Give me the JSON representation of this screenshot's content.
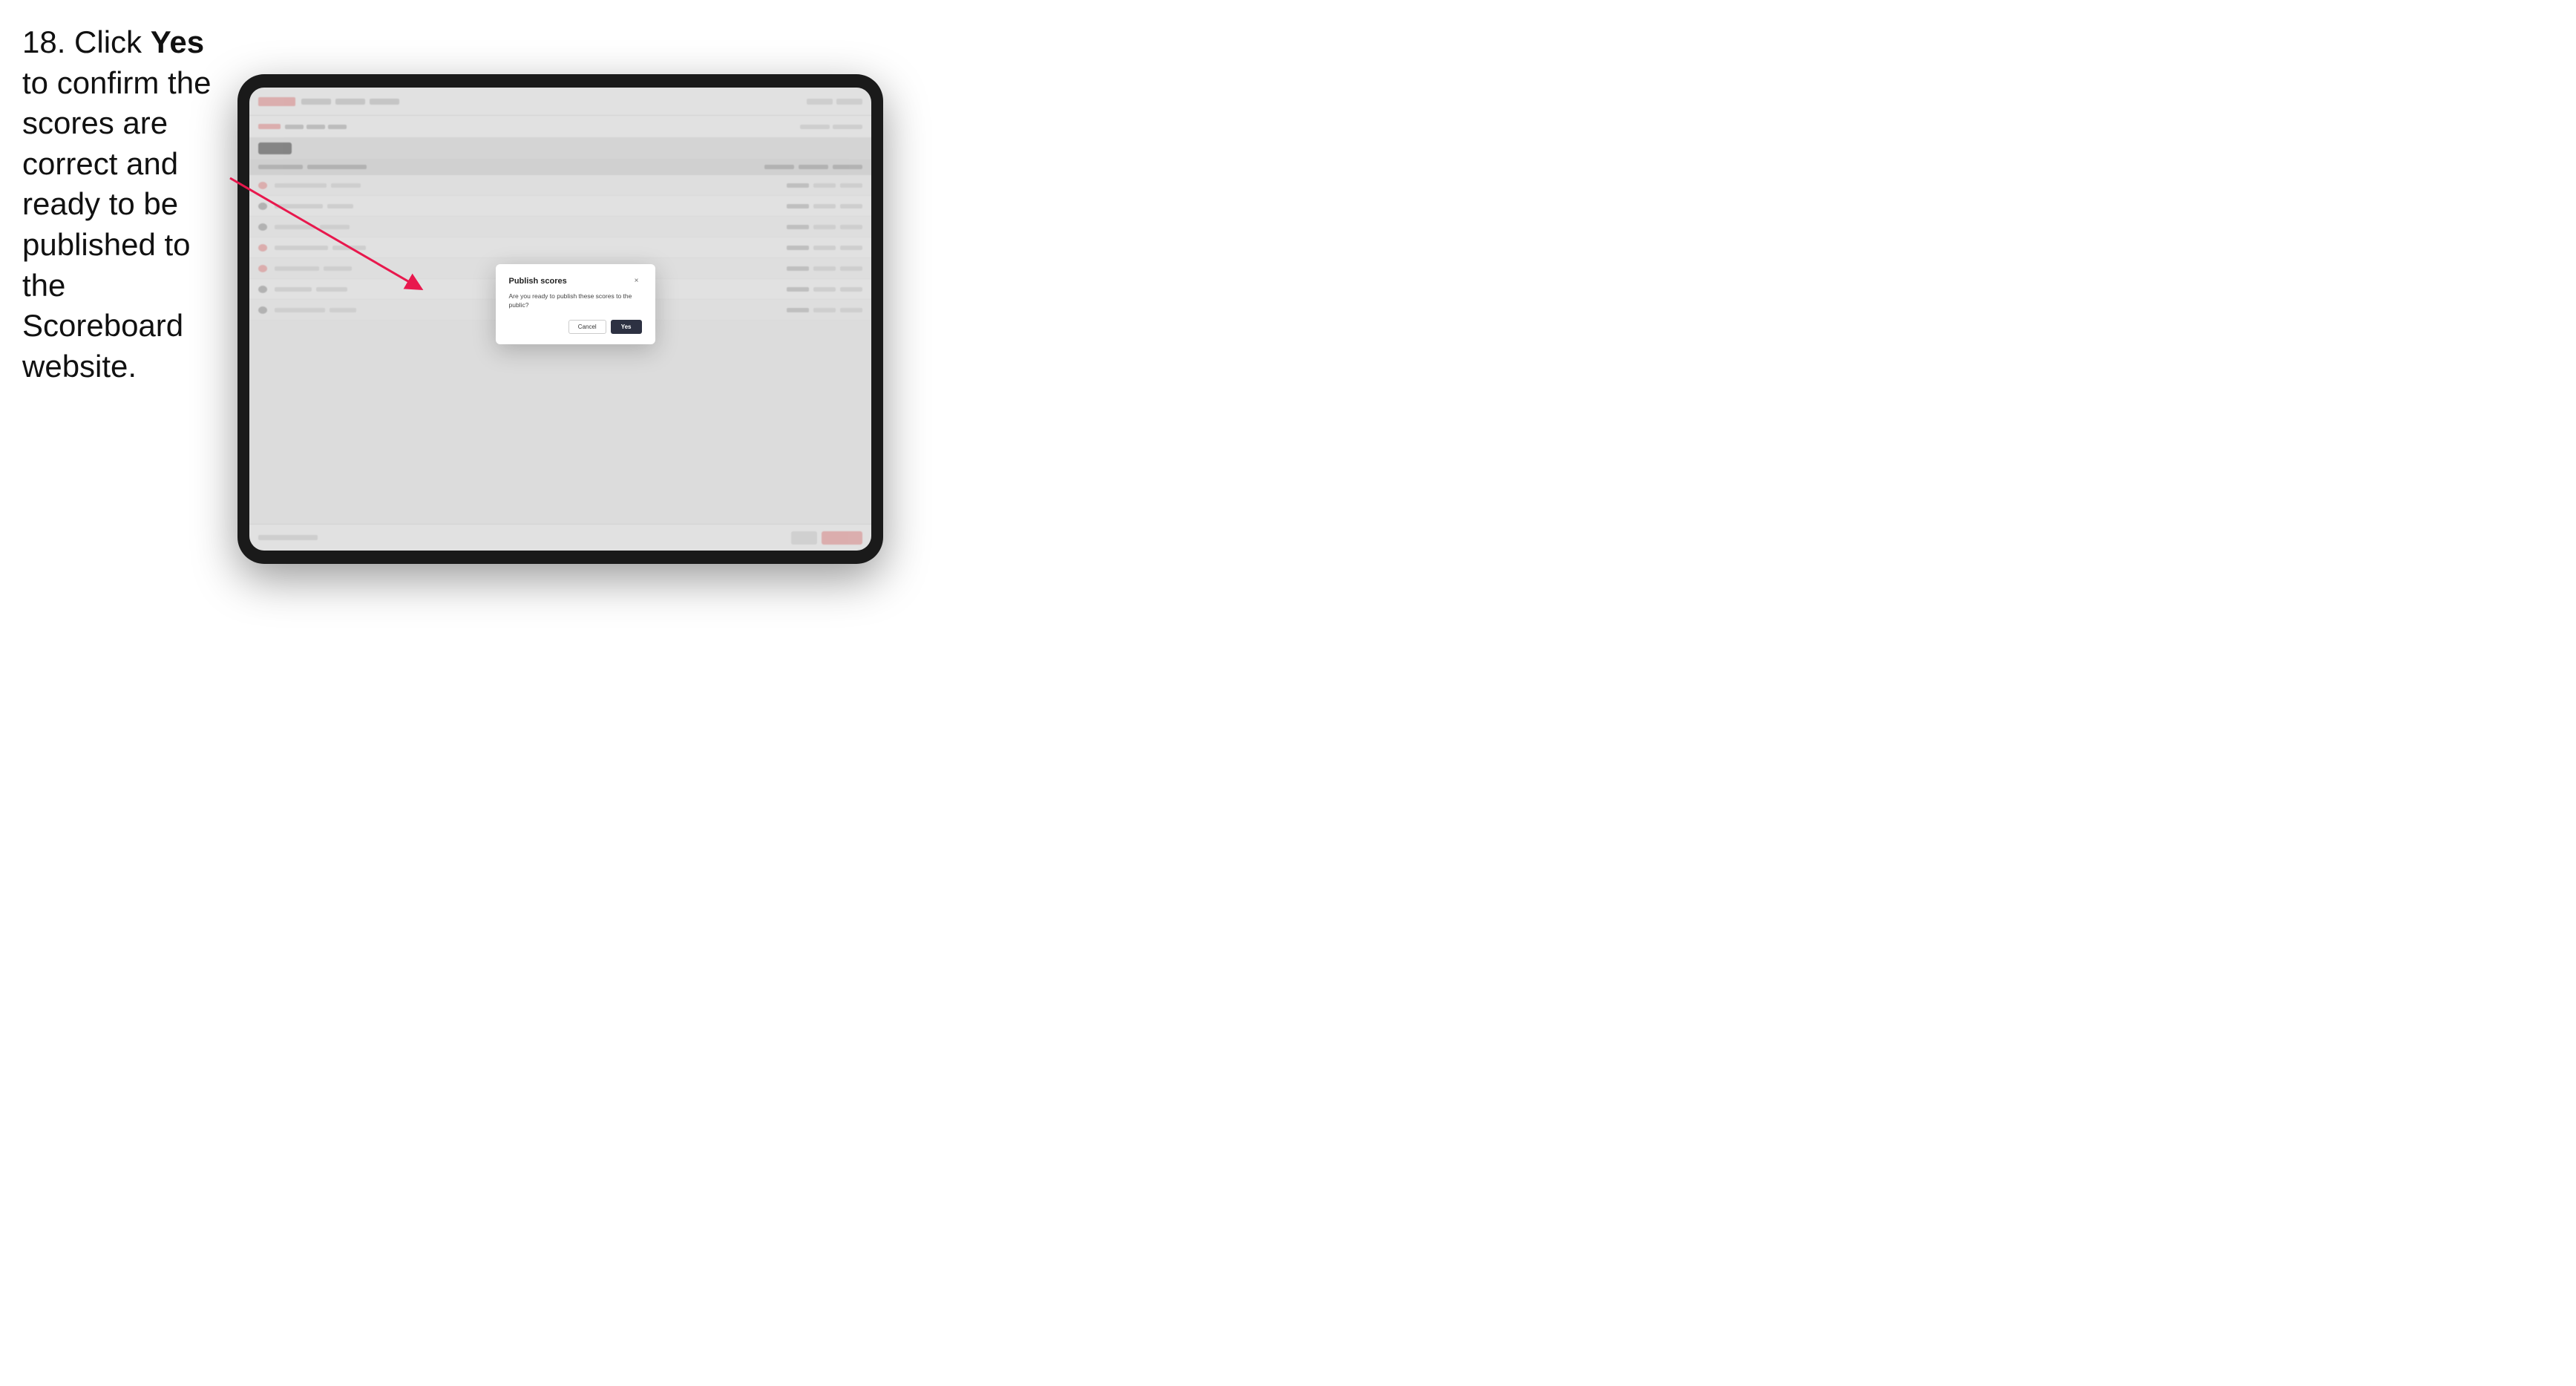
{
  "instruction": {
    "step": "18.",
    "text_before": " Click ",
    "bold": "Yes",
    "text_after": " to confirm the scores are correct and ready to be published to the Scoreboard website."
  },
  "tablet": {
    "dialog": {
      "title": "Publish scores",
      "body": "Are you ready to publish these scores to the public?",
      "cancel_label": "Cancel",
      "yes_label": "Yes",
      "close_label": "×"
    }
  }
}
